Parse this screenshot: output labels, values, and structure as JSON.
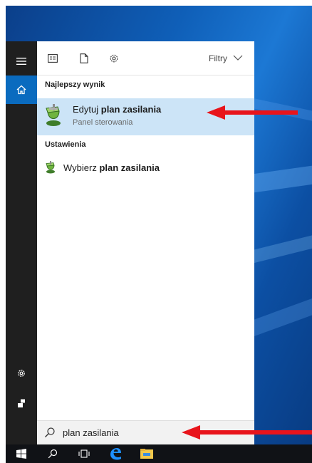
{
  "search": {
    "query": "plan zasilania"
  },
  "filter_bar": {
    "filters_label": "Filtry"
  },
  "sections": {
    "best_match_heading": "Najlepszy wynik",
    "settings_heading": "Ustawienia"
  },
  "best_result": {
    "title_prefix": "Edytuj ",
    "title_bold": "plan zasilania",
    "subtitle": "Panel sterowania"
  },
  "settings_result": {
    "title_prefix": "Wybierz ",
    "title_bold": "plan zasilania"
  },
  "colors": {
    "accent": "#0a6bbf",
    "selection": "#cce4f7",
    "arrow": "#e8141b",
    "rail": "#1f1f1f",
    "taskbar": "#101216"
  },
  "icons": {
    "rail": [
      "hamburger-icon",
      "home-icon",
      "settings-icon",
      "user-icon"
    ],
    "filter_bar": [
      "apps-icon",
      "document-icon",
      "settings-icon",
      "chevron-down-icon"
    ],
    "taskbar": [
      "windows-start-icon",
      "search-icon",
      "task-view-icon",
      "edge-browser-icon",
      "file-explorer-icon"
    ]
  }
}
